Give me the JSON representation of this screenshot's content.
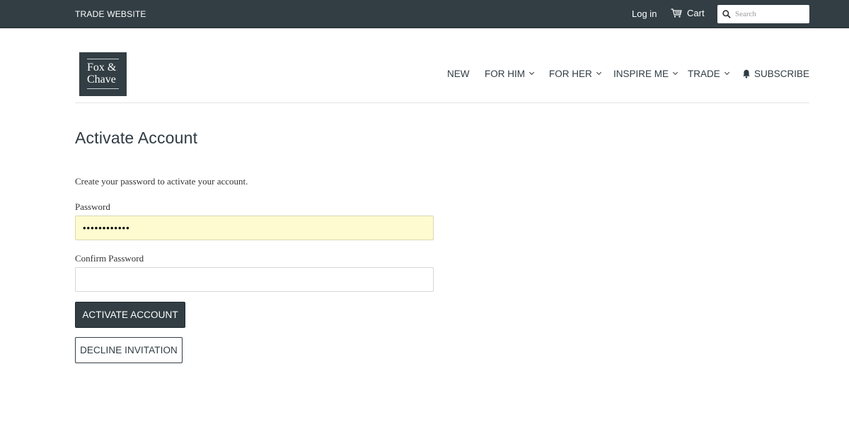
{
  "topbar": {
    "site_label": "TRADE WEBSITE",
    "login_label": "Log in",
    "cart_label": "Cart",
    "cart_icon": "cart-icon",
    "search_icon": "search-icon",
    "search_placeholder": "Search"
  },
  "logo": {
    "line1": "Fox &",
    "line2": "Chave"
  },
  "nav": {
    "items": [
      {
        "label": "NEW",
        "has_dropdown": false
      },
      {
        "label": "FOR HIM",
        "has_dropdown": true
      },
      {
        "label": "FOR HER",
        "has_dropdown": true
      },
      {
        "label": "INSPIRE ME",
        "has_dropdown": true
      },
      {
        "label": "TRADE",
        "has_dropdown": true
      },
      {
        "label": "SUBSCRIBE",
        "has_dropdown": false,
        "icon": "bell-icon"
      }
    ]
  },
  "main": {
    "title": "Activate Account",
    "intro": "Create your password to activate your account.",
    "password_label": "Password",
    "password_value": "••••••••••••",
    "confirm_label": "Confirm Password",
    "confirm_value": "",
    "activate_button": "ACTIVATE ACCOUNT",
    "decline_button": "DECLINE INVITATION"
  },
  "colors": {
    "brand_dark": "#323e44",
    "autofill_yellow": "#fefbd0",
    "text": "#2f3b42"
  }
}
